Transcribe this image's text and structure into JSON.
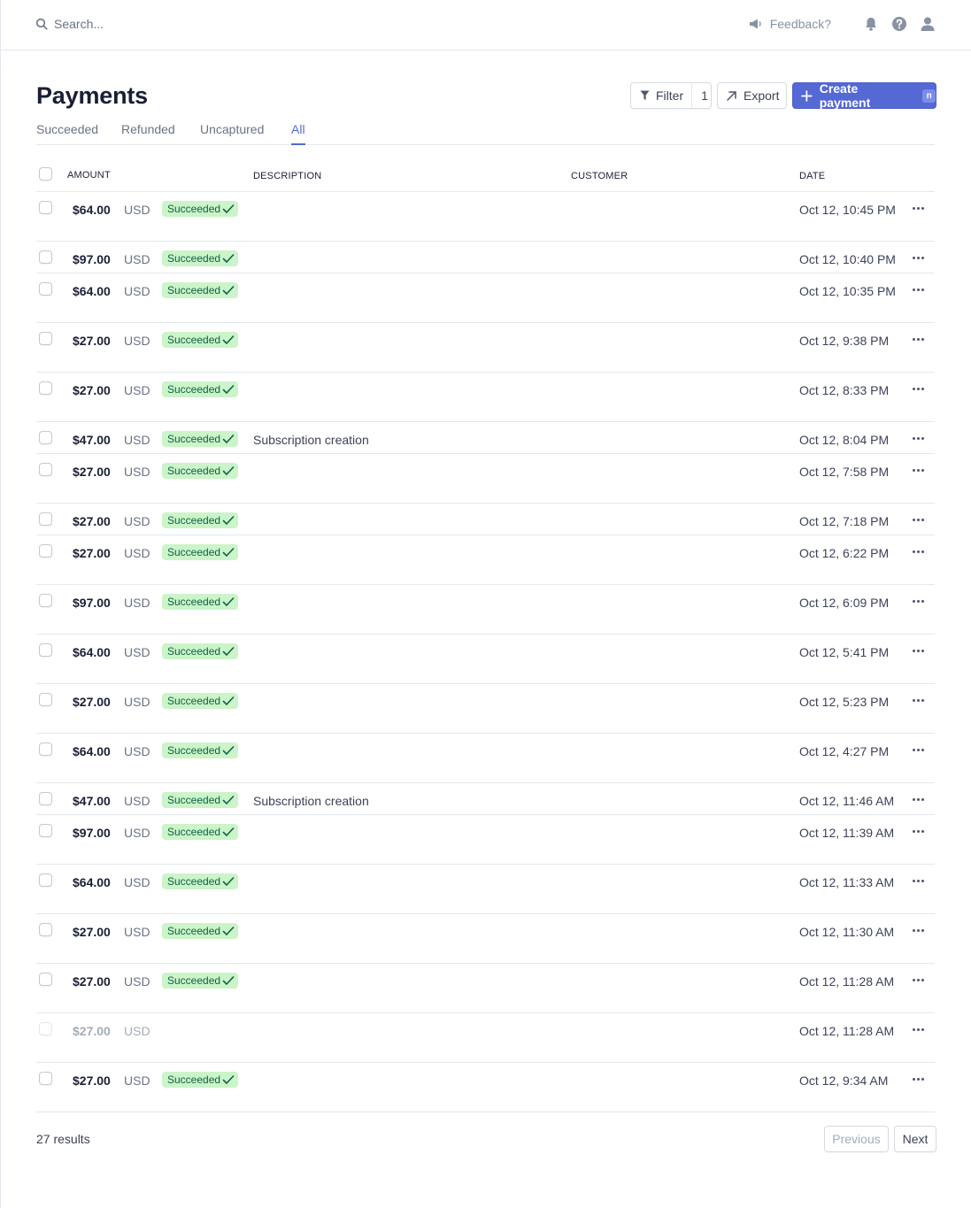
{
  "topbar": {
    "search_placeholder": "Search...",
    "feedback_label": "Feedback?"
  },
  "header": {
    "title": "Payments",
    "filter_label": "Filter",
    "filter_count": "1",
    "export_label": "Export",
    "create_label": "Create payment",
    "create_shortcut": "n"
  },
  "tabs": [
    {
      "label": "Succeeded",
      "active": false
    },
    {
      "label": "Refunded",
      "active": false
    },
    {
      "label": "Uncaptured",
      "active": false
    },
    {
      "label": "All",
      "active": true
    }
  ],
  "table": {
    "columns": {
      "amount": "AMOUNT",
      "description": "DESCRIPTION",
      "customer": "CUSTOMER",
      "date": "DATE"
    },
    "rows": [
      {
        "amount": "$64.00",
        "currency": "USD",
        "status": "Succeeded",
        "description": "",
        "customer": "",
        "date": "Oct 12, 10:45 PM"
      },
      {
        "amount": "$97.00",
        "currency": "USD",
        "status": "Succeeded",
        "description": "",
        "customer": "",
        "date": "Oct 12, 10:40 PM"
      },
      {
        "amount": "$64.00",
        "currency": "USD",
        "status": "Succeeded",
        "description": "",
        "customer": "",
        "date": "Oct 12, 10:35 PM"
      },
      {
        "amount": "$27.00",
        "currency": "USD",
        "status": "Succeeded",
        "description": "",
        "customer": "",
        "date": "Oct 12, 9:38 PM"
      },
      {
        "amount": "$27.00",
        "currency": "USD",
        "status": "Succeeded",
        "description": "",
        "customer": "",
        "date": "Oct 12, 8:33 PM"
      },
      {
        "amount": "$47.00",
        "currency": "USD",
        "status": "Succeeded",
        "description": "Subscription creation",
        "customer": "",
        "date": "Oct 12, 8:04 PM"
      },
      {
        "amount": "$27.00",
        "currency": "USD",
        "status": "Succeeded",
        "description": "",
        "customer": "",
        "date": "Oct 12, 7:58 PM"
      },
      {
        "amount": "$27.00",
        "currency": "USD",
        "status": "Succeeded",
        "description": "",
        "customer": "",
        "date": "Oct 12, 7:18 PM"
      },
      {
        "amount": "$27.00",
        "currency": "USD",
        "status": "Succeeded",
        "description": "",
        "customer": "",
        "date": "Oct 12, 6:22 PM"
      },
      {
        "amount": "$97.00",
        "currency": "USD",
        "status": "Succeeded",
        "description": "",
        "customer": "",
        "date": "Oct 12, 6:09 PM"
      },
      {
        "amount": "$64.00",
        "currency": "USD",
        "status": "Succeeded",
        "description": "",
        "customer": "",
        "date": "Oct 12, 5:41 PM"
      },
      {
        "amount": "$27.00",
        "currency": "USD",
        "status": "Succeeded",
        "description": "",
        "customer": "",
        "date": "Oct 12, 5:23 PM"
      },
      {
        "amount": "$64.00",
        "currency": "USD",
        "status": "Succeeded",
        "description": "",
        "customer": "",
        "date": "Oct 12, 4:27 PM"
      },
      {
        "amount": "$47.00",
        "currency": "USD",
        "status": "Succeeded",
        "description": "Subscription creation",
        "customer": "",
        "date": "Oct 12, 11:46 AM"
      },
      {
        "amount": "$97.00",
        "currency": "USD",
        "status": "Succeeded",
        "description": "",
        "customer": "",
        "date": "Oct 12, 11:39 AM"
      },
      {
        "amount": "$64.00",
        "currency": "USD",
        "status": "Succeeded",
        "description": "",
        "customer": "",
        "date": "Oct 12, 11:33 AM"
      },
      {
        "amount": "$27.00",
        "currency": "USD",
        "status": "Succeeded",
        "description": "",
        "customer": "",
        "date": "Oct 12, 11:30 AM"
      },
      {
        "amount": "$27.00",
        "currency": "USD",
        "status": "Succeeded",
        "description": "",
        "customer": "",
        "date": "Oct 12, 11:28 AM"
      },
      {
        "amount": "$27.00",
        "currency": "USD",
        "status": "",
        "description": "",
        "customer": "",
        "date": "Oct 12, 11:28 AM"
      },
      {
        "amount": "$27.00",
        "currency": "USD",
        "status": "Succeeded",
        "description": "",
        "customer": "",
        "date": "Oct 12, 9:34 AM"
      }
    ]
  },
  "footer": {
    "results_label": "27 results",
    "previous_label": "Previous",
    "next_label": "Next"
  },
  "colors": {
    "accent": "#5469d4",
    "success_bg": "#cbf4c9",
    "success_text": "#0e6245",
    "title": "#1a1f36"
  },
  "icons": {
    "search": "search-icon",
    "feedback": "megaphone-icon",
    "notifications": "bell-icon",
    "help": "help-icon",
    "account": "user-icon",
    "filter": "funnel-icon",
    "export": "arrow-up-right-icon",
    "create": "plus-icon",
    "status": "check-icon",
    "row_actions": "more-dots-icon"
  }
}
